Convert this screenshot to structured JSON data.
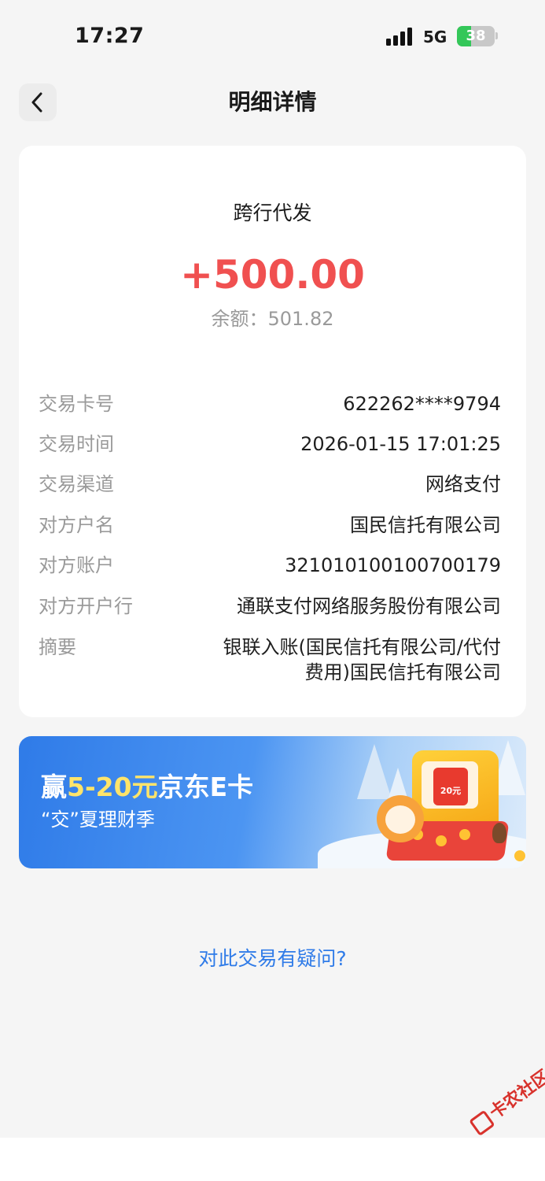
{
  "status_bar": {
    "time": "17:27",
    "network": "5G",
    "battery_percent": "38",
    "battery_level": 0.38
  },
  "nav": {
    "title": "明细详情",
    "back_icon": "chevron-left-icon"
  },
  "transaction": {
    "type": "跨行代发",
    "amount": "+500.00",
    "amount_color": "#f05050",
    "balance_label": "余额：",
    "balance_value": "501.82"
  },
  "details": [
    {
      "label": "交易卡号",
      "value": "622262****9794"
    },
    {
      "label": "交易时间",
      "value": "2026-01-15 17:01:25"
    },
    {
      "label": "交易渠道",
      "value": "网络支付"
    },
    {
      "label": "对方户名",
      "value": "国民信托有限公司"
    },
    {
      "label": "对方账户",
      "value": "321010100100700179"
    },
    {
      "label": "对方开户行",
      "value": "通联支付网络服务股份有限公司"
    },
    {
      "label": "摘要",
      "value": "银联入账(国民信托有限公司/代付费用)国民信托有限公司"
    }
  ],
  "banner": {
    "title_prefix": "赢",
    "title_highlight": "5-20元",
    "title_suffix": "京东E卡",
    "subtitle": "“交”夏理财季",
    "envelope_text": "20元"
  },
  "question_link": "对此交易有疑问?",
  "watermark": "卡农社区",
  "colors": {
    "accent_blue": "#2f7be8",
    "amount_red": "#f05050",
    "label_gray": "#9a9a9a"
  }
}
